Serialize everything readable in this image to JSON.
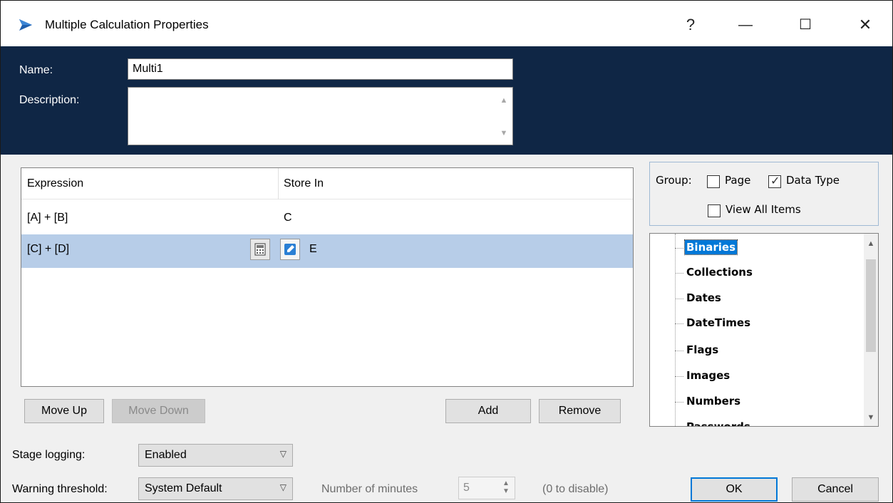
{
  "window": {
    "title": "Multiple Calculation Properties",
    "icons": {
      "app": "blue-arrow-icon",
      "help": "help-icon",
      "minimize": "minimize-icon",
      "maximize": "maximize-icon",
      "close": "close-icon"
    },
    "help_glyph": "?",
    "min_glyph": "—",
    "max_glyph": "☐",
    "close_glyph": "✕"
  },
  "header": {
    "name_label": "Name:",
    "name_value": "Multi1",
    "description_label": "Description:",
    "description_value": "",
    "background_color": "#0f2645"
  },
  "grid": {
    "columns": [
      "Expression",
      "Store In"
    ],
    "rows": [
      {
        "expression": "[A] + [B]",
        "store_in": "C",
        "selected": false
      },
      {
        "expression": "[C] + [D]",
        "store_in": "E",
        "selected": true
      }
    ],
    "selected_row_color": "#b7cde8"
  },
  "buttons": {
    "move_up": "Move Up",
    "move_down": "Move Down",
    "add": "Add",
    "remove": "Remove",
    "ok": "OK",
    "cancel": "Cancel"
  },
  "group": {
    "label": "Group:",
    "page": {
      "label": "Page",
      "checked": false
    },
    "data_type": {
      "label": "Data Type",
      "checked": true
    },
    "view_all": {
      "label": "View All Items",
      "checked": false
    }
  },
  "tree": {
    "items": [
      "Binaries",
      "Collections",
      "Dates",
      "DateTimes",
      "Flags",
      "Images",
      "Numbers",
      "Passwords"
    ],
    "selected": "Binaries"
  },
  "settings": {
    "stage_logging_label": "Stage logging:",
    "stage_logging_value": "Enabled",
    "warning_threshold_label": "Warning threshold:",
    "warning_threshold_value": "System Default",
    "minutes_label": "Number of minutes",
    "minutes_value": "5",
    "disable_hint": "(0 to disable)"
  }
}
